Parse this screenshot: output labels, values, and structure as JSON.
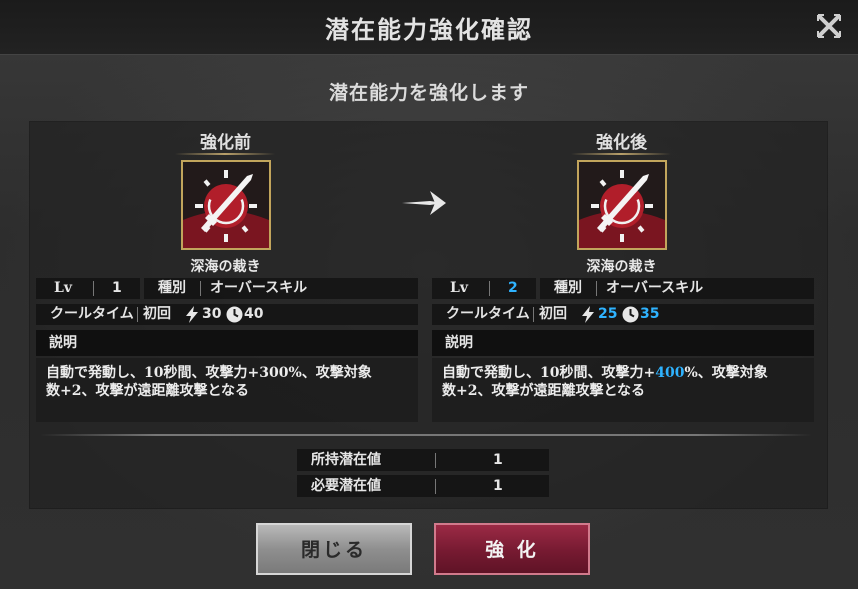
{
  "header": {
    "title": "潜在能力強化確認",
    "close_icon": "close-x-icon"
  },
  "subtitle": "潜在能力を強化します",
  "before": {
    "heading": "強化前",
    "skill_name": "深海の裁き",
    "lv_label": "Lv",
    "lv_value": "1",
    "type_label": "種別",
    "type_value": "オーバースキル",
    "cooltime_label": "クールタイム",
    "initial_label": "初回",
    "initial_value": "30",
    "recast_value": "40",
    "desc_label": "説明",
    "desc_line1_prefix": "自動で発動し、10秒間、攻撃力+",
    "desc_line1_value": "300",
    "desc_line1_suffix": "%、攻撃対象",
    "desc_line2": "数+2、攻撃が遠距離攻撃となる"
  },
  "after": {
    "heading": "強化後",
    "skill_name": "深海の裁き",
    "lv_label": "Lv",
    "lv_value": "2",
    "type_label": "種別",
    "type_value": "オーバースキル",
    "cooltime_label": "クールタイム",
    "initial_label": "初回",
    "initial_value": "25",
    "recast_value": "35",
    "desc_label": "説明",
    "desc_line1_prefix": "自動で発動し、10秒間、攻撃力+",
    "desc_line1_value": "400",
    "desc_line1_suffix": "%、攻撃対象",
    "desc_line2": "数+2、攻撃が遠距離攻撃となる"
  },
  "stats": {
    "owned_label": "所持潜在値",
    "owned_value": "1",
    "required_label": "必要潜在値",
    "required_value": "1"
  },
  "buttons": {
    "close": "閉じる",
    "enhance": "強 化"
  },
  "colors": {
    "highlight": "#2fb3ff",
    "enhance_button": "#761a31",
    "icon_border": "#c2a55c"
  }
}
